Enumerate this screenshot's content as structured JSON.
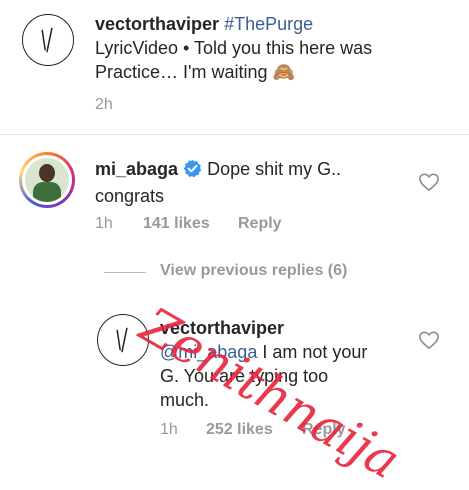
{
  "post": {
    "username": "vectorthaviper",
    "hashtag": "#ThePurge",
    "caption_line1": "LyricVideo • Told you this here was",
    "caption_line2": "Practice… I'm waiting",
    "emoji": "🙈",
    "time": "2h"
  },
  "comment": {
    "username": "mi_abaga",
    "verified_icon": "verified-badge-icon",
    "text_line1": "Dope shit my G..",
    "text_line2": "congrats",
    "time": "1h",
    "likes": "141 likes",
    "reply": "Reply"
  },
  "view_replies": "View previous replies (6)",
  "reply": {
    "username": "vectorthaviper",
    "mention": "@mi_abaga",
    "text_line1_rest": " I am not your",
    "text_line2": "G. You are typing too",
    "text_line3": "much.",
    "time": "1h",
    "likes": "252 likes",
    "reply": "Reply"
  },
  "watermark": "Zenithnaija",
  "colors": {
    "link_blue": "#3a5f92",
    "verified_blue": "#3897f0",
    "meta_gray": "#999999",
    "watermark_red": "#e8243c"
  }
}
